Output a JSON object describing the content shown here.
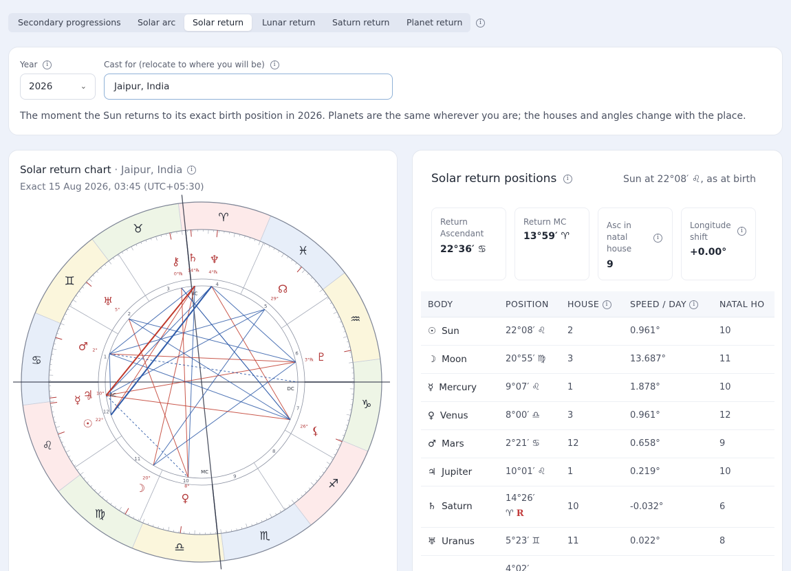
{
  "tabs": [
    {
      "label": "Secondary progressions",
      "active": false
    },
    {
      "label": "Solar arc",
      "active": false
    },
    {
      "label": "Solar return",
      "active": true
    },
    {
      "label": "Lunar return",
      "active": false
    },
    {
      "label": "Saturn return",
      "active": false
    },
    {
      "label": "Planet return",
      "active": false
    }
  ],
  "settings": {
    "year_label": "Year",
    "year_value": "2026",
    "cast_label": "Cast for (relocate to where you will be)",
    "cast_value": "Jaipur, India",
    "description": "The moment the Sun returns to its exact birth position in 2026. Planets are the same wherever you are; the houses and angles change with the place."
  },
  "chart_panel": {
    "title": "Solar return chart",
    "place": "Jaipur, India",
    "exact": "Exact 15 Aug 2026, 03:45 (UTC+05:30)"
  },
  "wheel": {
    "signs": [
      "♈",
      "♉",
      "♊",
      "♋",
      "♌",
      "♍",
      "♎",
      "♏",
      "♐",
      "♑",
      "♒",
      "♓"
    ],
    "house_numbers": [
      "1",
      "2",
      "3",
      "4",
      "5",
      "6",
      "7",
      "8",
      "9",
      "10",
      "11",
      "12"
    ],
    "angles": {
      "asc": "AC",
      "dc": "DC",
      "mc": "MC",
      "ic": "IC"
    },
    "planets": [
      {
        "glyph": "⚷",
        "degree": "0°℞"
      },
      {
        "glyph": "♄",
        "degree": "14°℞"
      },
      {
        "glyph": "♆",
        "degree": "4°℞"
      },
      {
        "glyph": "☊",
        "degree": "29°"
      },
      {
        "glyph": "♇",
        "degree": "3°℞"
      },
      {
        "glyph": "⚸",
        "degree": "26°"
      },
      {
        "glyph": "♅",
        "degree": "5°"
      },
      {
        "glyph": "♂",
        "degree": "2°"
      },
      {
        "glyph": "☿",
        "degree": "9°"
      },
      {
        "glyph": "♃",
        "degree": "10°"
      },
      {
        "glyph": "☉",
        "degree": "22°"
      },
      {
        "glyph": "☽",
        "degree": "20°"
      },
      {
        "glyph": "♀",
        "degree": "8°"
      }
    ]
  },
  "positions": {
    "title": "Solar return positions",
    "subtitle": "Sun at 22°08′ ♌, as at birth",
    "stats": [
      {
        "label": "Return Ascendant",
        "value": "22°36′ ♋"
      },
      {
        "label": "Return MC",
        "value": "13°59′ ♈"
      },
      {
        "label": "Asc in natal house",
        "value": "9"
      },
      {
        "label": "Longitude shift",
        "value": "+0.00°"
      }
    ],
    "columns": [
      "BODY",
      "POSITION",
      "HOUSE",
      "SPEED / DAY",
      "NATAL HO"
    ],
    "rows": [
      {
        "glyph": "☉",
        "body": "Sun",
        "position": "22°08′ ♌",
        "house": "2",
        "speed": "0.961°",
        "natal": "10"
      },
      {
        "glyph": "☽",
        "body": "Moon",
        "position": "20°55′ ♍",
        "house": "3",
        "speed": "13.687°",
        "natal": "11"
      },
      {
        "glyph": "☿",
        "body": "Mercury",
        "position": "9°07′ ♌",
        "house": "1",
        "speed": "1.878°",
        "natal": "10"
      },
      {
        "glyph": "♀",
        "body": "Venus",
        "position": "8°00′ ♎",
        "house": "3",
        "speed": "0.961°",
        "natal": "12"
      },
      {
        "glyph": "♂",
        "body": "Mars",
        "position": "2°21′ ♋",
        "house": "12",
        "speed": "0.658°",
        "natal": "9"
      },
      {
        "glyph": "♃",
        "body": "Jupiter",
        "position": "10°01′ ♌",
        "house": "1",
        "speed": "0.219°",
        "natal": "10"
      },
      {
        "glyph": "♄",
        "body": "Saturn",
        "position": "14°26′",
        "position2": "♈",
        "retro": "R",
        "house": "10",
        "speed": "-0.032°",
        "natal": "6"
      },
      {
        "glyph": "♅",
        "body": "Uranus",
        "position": "5°23′ ♊",
        "house": "11",
        "speed": "0.022°",
        "natal": "8"
      },
      {
        "glyph": "",
        "body": "",
        "position": "4°02′",
        "house": "",
        "speed": "",
        "natal": ""
      }
    ]
  }
}
